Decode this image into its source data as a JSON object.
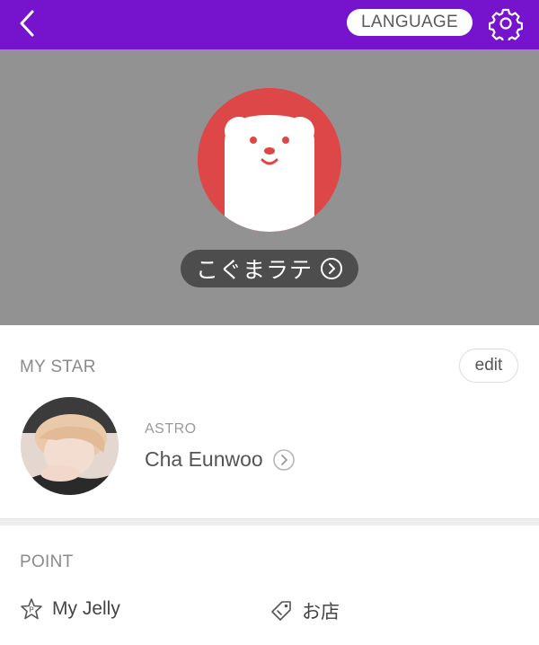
{
  "topbar": {
    "background": "#7613cc",
    "back_icon": "chevron-left-icon",
    "language_label": "LANGUAGE",
    "settings_icon": "gear-icon"
  },
  "profile": {
    "avatar_icon": "polar-bear-icon",
    "avatar_bg": "#dd4747",
    "nickname": "こぐまラテ",
    "nickname_icon": "chevron-right-circle-icon"
  },
  "my_star": {
    "title": "MY STAR",
    "edit_label": "edit",
    "star": {
      "group": "ASTRO",
      "name": "Cha Eunwoo",
      "link_icon": "chevron-right-circle-icon"
    }
  },
  "point": {
    "title": "POINT",
    "items": [
      {
        "label": "My Jelly",
        "icon": "star-jelly-icon"
      },
      {
        "label": "お店",
        "icon": "shop-tag-icon"
      }
    ]
  }
}
